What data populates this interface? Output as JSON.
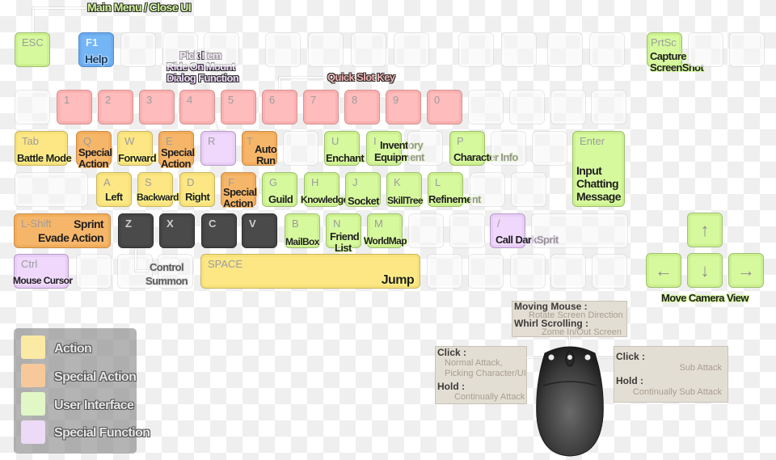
{
  "callouts": {
    "main_menu": "Main Menu / Close UI",
    "pick_item": [
      "Pick Item",
      "Ride On Mount",
      "Dialog Function"
    ],
    "quick_slot": "Quick Slot Key",
    "control_summon": [
      "Control",
      "Summon"
    ],
    "move_camera": "Move Camera View"
  },
  "keys": {
    "esc": {
      "cap": "ESC"
    },
    "f1": {
      "cap": "F1",
      "label": "Help"
    },
    "prtsc": {
      "cap": "PrtSc",
      "label": [
        "Capture",
        "ScreenShot"
      ]
    },
    "num": [
      "1",
      "2",
      "3",
      "4",
      "5",
      "6",
      "7",
      "8",
      "9",
      "0"
    ],
    "tab": {
      "cap": "Tab",
      "label": "Battle Mode"
    },
    "q": {
      "cap": "Q",
      "label": [
        "Special",
        "Action"
      ]
    },
    "w": {
      "cap": "W",
      "label": "Forward"
    },
    "e": {
      "cap": "E",
      "label": [
        "Special",
        "Action"
      ]
    },
    "r": {
      "cap": "R"
    },
    "t": {
      "cap": "T",
      "label": [
        "Auto",
        "Run"
      ]
    },
    "u": {
      "cap": "U",
      "label": "Enchant"
    },
    "i": {
      "cap": "I",
      "label": [
        "Inventory",
        "Equipment"
      ]
    },
    "p": {
      "cap": "P",
      "label": "Character Info"
    },
    "enter": {
      "cap": "Enter",
      "label": [
        "Input",
        "Chatting",
        "Message"
      ]
    },
    "a": {
      "cap": "A",
      "label": "Left"
    },
    "s": {
      "cap": "S",
      "label": "Backward"
    },
    "d": {
      "cap": "D",
      "label": "Right"
    },
    "f": {
      "cap": "F",
      "label": [
        "Special",
        "Action"
      ]
    },
    "g": {
      "cap": "G",
      "label": "Guild"
    },
    "h": {
      "cap": "H",
      "label": "Knowledge"
    },
    "j": {
      "cap": "J",
      "label": "Socket"
    },
    "k": {
      "cap": "K",
      "label": "SkillTree"
    },
    "l": {
      "cap": "L",
      "label": "Refinement"
    },
    "lshift": {
      "cap": "L-Shift",
      "label": [
        "Sprint",
        "Evade Action"
      ]
    },
    "z": {
      "cap": "Z"
    },
    "x": {
      "cap": "X"
    },
    "c": {
      "cap": "C"
    },
    "v": {
      "cap": "V"
    },
    "b": {
      "cap": "B",
      "label": "MailBox"
    },
    "n": {
      "cap": "N",
      "label": [
        "Friend",
        "List"
      ]
    },
    "m": {
      "cap": "M",
      "label": "WorldMap"
    },
    "slash": {
      "cap": "/",
      "label": "Call DarkSprit"
    },
    "ctrl": {
      "cap": "Ctrl",
      "label": "Mouse Cursor"
    },
    "space": {
      "cap": "SPACE",
      "label": "Jump"
    },
    "up": {
      "glyph": "↑"
    },
    "left": {
      "glyph": "←"
    },
    "down": {
      "glyph": "↓"
    },
    "right": {
      "glyph": "→"
    }
  },
  "legend": [
    {
      "label": "Action",
      "color": "#fde784"
    },
    {
      "label": "Special Action",
      "color": "#f6b66a"
    },
    {
      "label": "User Interface",
      "color": "#d6f99e"
    },
    {
      "label": "Special Function",
      "color": "#efd8fb"
    }
  ],
  "mouse": {
    "top": {
      "h1": "Moving Mouse :",
      "t1": "Rotate Screen Direction",
      "h2": "Whirl Scrolling :",
      "t2": "Zome In/Out Screen"
    },
    "left": {
      "h1": "Click :",
      "t1a": "Normal Attack,",
      "t1b": "Picking Character/UI",
      "h2": "Hold :",
      "t2": "Continually Attack"
    },
    "right": {
      "h1": "Click :",
      "t1": "Sub Attack",
      "h2": "Hold :",
      "t2": "Continually Sub Attack"
    }
  }
}
